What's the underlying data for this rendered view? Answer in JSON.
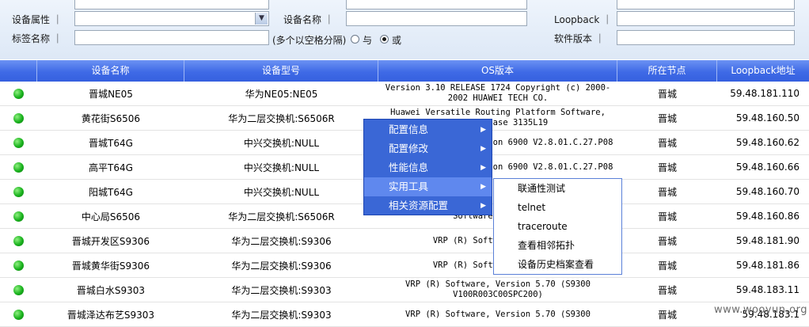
{
  "filters": {
    "device_attr_label": "设备属性 ｜",
    "device_name_label": "设备名称 ｜",
    "loopback_label": "Loopback ｜",
    "tag_name_label": "标签名称 ｜",
    "tag_hint": "(多个以空格分隔)",
    "radio_and": "与",
    "radio_or": "或",
    "software_version_label": "软件版本 ｜",
    "selected_radio": "或"
  },
  "table": {
    "headers": [
      "设备名称",
      "设备型号",
      "OS版本",
      "所在节点",
      "Loopback地址"
    ],
    "rows": [
      {
        "name": "晋城NE05",
        "model": "华为NE05:NE05",
        "os": "Version 3.10 RELEASE 1724 Copyright (c) 2000-2002 HUAWEI TECH CO.",
        "node": "晋城",
        "ip": "59.48.181.110"
      },
      {
        "name": "黄花街S6506",
        "model": "华为二层交换机:S6506R",
        "os": "Huawei Versatile Routing Platform Software, .10, Release 3135L19",
        "node": "晋城",
        "ip": "59.48.160.50"
      },
      {
        "name": "晋城T64G",
        "model": "中兴交换机:NULL",
        "os": "10 T64G Software Version 6900 V2.8.01.C.27.P08",
        "node": "晋城",
        "ip": "59.48.160.62"
      },
      {
        "name": "高平T64G",
        "model": "中兴交换机:NULL",
        "os": "10 T64G Software Version 6900 V2.8.01.C.27.P08",
        "node": "晋城",
        "ip": "59.48.160.66"
      },
      {
        "name": "阳城T64G",
        "model": "中兴交换机:NULL",
        "os": "",
        "node": "晋城",
        "ip": "59.48.160.70"
      },
      {
        "name": "中心局S6506",
        "model": "华为二层交换机:S6506R",
        "os": "Software Version 3",
        "node": "晋城",
        "ip": "59.48.160.86"
      },
      {
        "name": "晋城开发区S9306",
        "model": "华为二层交换机:S9306",
        "os": "VRP (R) Software, V100R003",
        "node": "晋城",
        "ip": "59.48.181.90"
      },
      {
        "name": "晋城黄华街S9306",
        "model": "华为二层交换机:S9306",
        "os": "VRP (R) Software, V100R003",
        "node": "晋城",
        "ip": "59.48.181.86"
      },
      {
        "name": "晋城白水S9303",
        "model": "华为二层交换机:S9303",
        "os": "VRP (R) Software, Version 5.70 (S9300 V100R003C00SPC200)",
        "node": "晋城",
        "ip": "59.48.183.11"
      },
      {
        "name": "晋城泽达布艺S9303",
        "model": "华为二层交换机:S9303",
        "os": "VRP (R) Software, Version 5.70 (S9300",
        "node": "晋城",
        "ip": "59.48.183.1"
      }
    ]
  },
  "context_menu": {
    "items": [
      {
        "label": "配置信息",
        "arrow": "▶"
      },
      {
        "label": "配置修改",
        "arrow": "▶"
      },
      {
        "label": "性能信息",
        "arrow": "▶"
      },
      {
        "label": "实用工具",
        "arrow": "▶"
      },
      {
        "label": "相关资源配置",
        "arrow": "▶"
      }
    ],
    "highlighted": "实用工具",
    "submenu": [
      "联通性测试",
      "telnet",
      "traceroute",
      "查看相邻拓扑",
      "设备历史档案查看"
    ]
  },
  "watermark": "www.wooyun.org",
  "colors": {
    "header_blue": "#3f6ae6",
    "menu_blue": "#3a67d6",
    "status_green": "#19b21d"
  }
}
